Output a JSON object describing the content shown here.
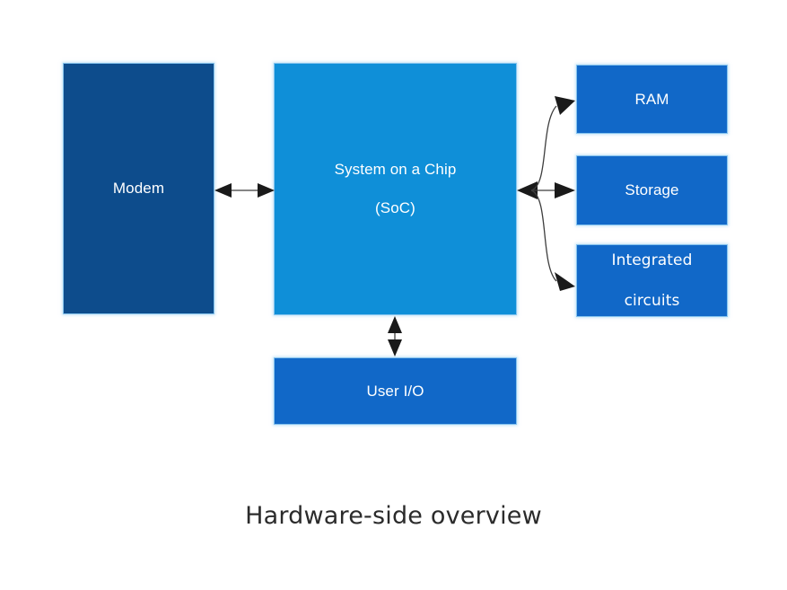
{
  "diagram": {
    "title": "Hardware-side overview",
    "background_color": "#ffffff",
    "nodes": {
      "modem": {
        "label": "Modem",
        "color": "#0d4c8c"
      },
      "soc": {
        "label_line1": "System on a Chip",
        "label_line2": "(SoC)",
        "color": "#0f8fd8"
      },
      "ram": {
        "label": "RAM",
        "color": "#1168c8"
      },
      "storage": {
        "label": "Storage",
        "color": "#1168c8"
      },
      "integrated_circuits": {
        "label_line1": "Integrated",
        "label_line2": "circuits",
        "color": "#1168c8"
      },
      "user_io": {
        "label": "User I/O",
        "color": "#1168c8"
      }
    },
    "connectors": [
      {
        "name": "modem-soc",
        "from": "modem",
        "to": "soc",
        "style": "double-arrow-horizontal"
      },
      {
        "name": "soc-ram",
        "from": "soc",
        "to": "ram",
        "style": "curved-arrow"
      },
      {
        "name": "soc-storage",
        "from": "soc",
        "to": "storage",
        "style": "straight-arrow"
      },
      {
        "name": "soc-integrated-circuits",
        "from": "soc",
        "to": "integrated_circuits",
        "style": "curved-arrow"
      },
      {
        "name": "soc-user-io",
        "from": "soc",
        "to": "user_io",
        "style": "double-arrow-vertical"
      }
    ],
    "line_color": "#3d3d3d"
  }
}
